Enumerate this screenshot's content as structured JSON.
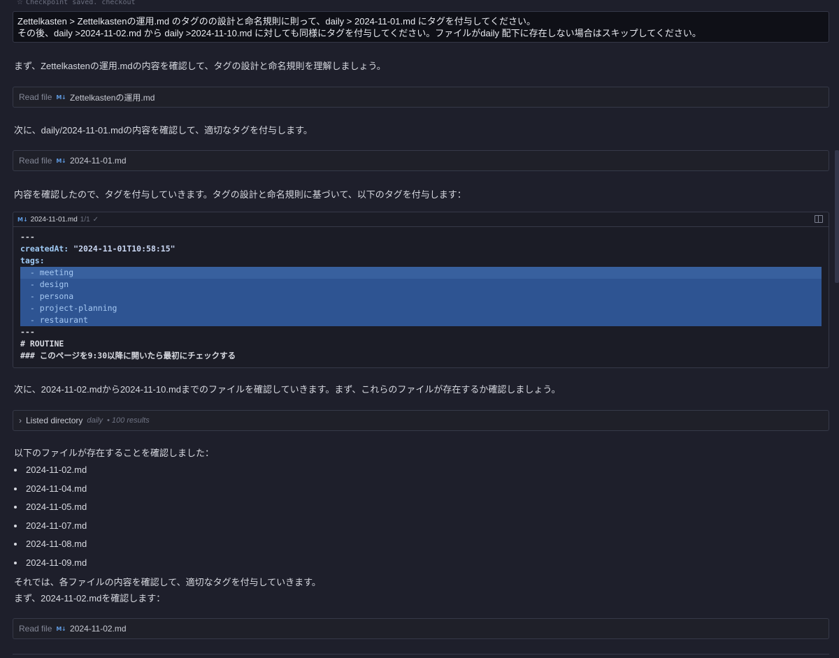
{
  "checkpoint": {
    "text": "Checkpoint saved. checkout",
    "icon": "star-icon"
  },
  "user_message": {
    "line1": "Zettelkasten > Zettelkastenの運用.md のタグのの設計と命名規則に則って、daily > 2024-11-01.md にタグを付与してください。",
    "line2": "その後、daily >2024-11-02.md  から daily >2024-11-10.md に対しても同様にタグを付与してください。ファイルがdaily 配下に存在しない場合はスキップしてください。"
  },
  "messages": {
    "p1": "まず、Zettelkastenの運用.mdの内容を確認して、タグの設計と命名規則を理解しましょう。",
    "p2": "次に、daily/2024-11-01.mdの内容を確認して、適切なタグを付与します。",
    "p3": "内容を確認したので、タグを付与していきます。タグの設計と命名規則に基づいて、以下のタグを付与します：",
    "p4": "次に、2024-11-02.mdから2024-11-10.mdまでのファイルを確認していきます。まず、これらのファイルが存在するか確認しましょう。",
    "p5": "以下のファイルが存在することを確認しました：",
    "p6": "それでは、各ファイルの内容を確認して、適切なタグを付与していきます。",
    "p7": "まず、2024-11-02.mdを確認します："
  },
  "tools": {
    "read1": {
      "label": "Read file",
      "icon": "M↓",
      "file": "Zettelkastenの運用.md"
    },
    "read2": {
      "label": "Read file",
      "icon": "M↓",
      "file": "2024-11-01.md"
    },
    "listdir": {
      "label": "Listed directory",
      "dir": "daily",
      "meta": "• 100 results"
    },
    "read3": {
      "label": "Read file",
      "icon": "M↓",
      "file": "2024-11-02.md"
    }
  },
  "editor": {
    "icon": "M↓",
    "file": "2024-11-01.md",
    "count": "1/1",
    "check": "✓",
    "lines": {
      "l1": "---",
      "l2_key": "createdAt:",
      "l2_val": " \"2024-11-01T10:58:15\"",
      "l3": "tags:",
      "tags": [
        "  - meeting",
        "  - design",
        "  - persona",
        "  - project-planning",
        "  - restaurant"
      ],
      "l9": "---",
      "l10": "# ROUTINE",
      "l11": "### このページを9:30以降に開いたら最初にチェックする"
    }
  },
  "files_found": [
    "2024-11-02.md",
    "2024-11-04.md",
    "2024-11-05.md",
    "2024-11-07.md",
    "2024-11-08.md",
    "2024-11-09.md"
  ]
}
